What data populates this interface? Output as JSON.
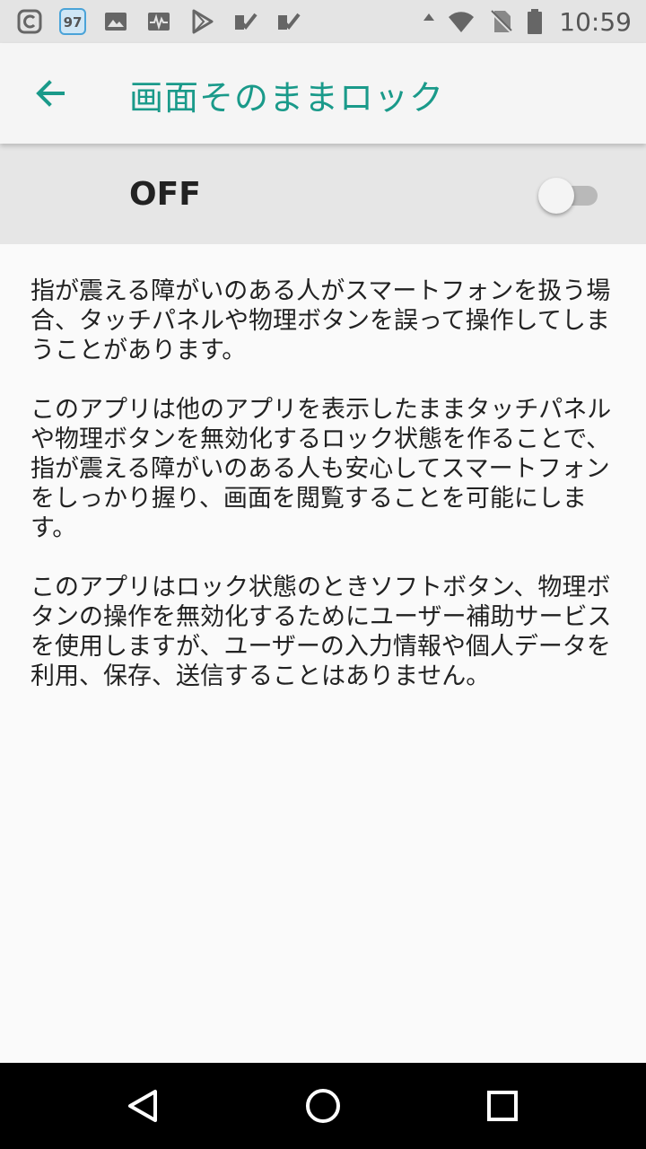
{
  "status_bar": {
    "time": "10:59",
    "notification_badge": "97",
    "left_icons": [
      "app-c-icon",
      "badge-97-icon",
      "image-icon",
      "pulse-icon",
      "play-store-icon",
      "check-icon",
      "check-icon"
    ],
    "right_icons": [
      "data-arrow-icon",
      "wifi-icon",
      "no-sim-icon",
      "battery-icon"
    ]
  },
  "app_bar": {
    "title": "画面そのままロック",
    "accent_color": "#1a9a8a"
  },
  "toggle": {
    "label": "OFF",
    "state": "off"
  },
  "content": {
    "paragraphs": [
      "指が震える障がいのある人がスマートフォンを扱う場合、タッチパネルや物理ボタンを誤って操作してしまうことがあります。",
      "このアプリは他のアプリを表示したままタッチパネルや物理ボタンを無効化するロック状態を作ることで、指が震える障がいのある人も安心してスマートフォンをしっかり握り、画面を閲覧することを可能にします。",
      "このアプリはロック状態のときソフトボタン、物理ボタンの操作を無効化するためにユーザー補助サービスを使用しますが、ユーザーの入力情報や個人データを利用、保存、送信することはありません。"
    ]
  },
  "nav_bar": {
    "icons": [
      "back-triangle-icon",
      "home-circle-icon",
      "recents-square-icon"
    ]
  }
}
